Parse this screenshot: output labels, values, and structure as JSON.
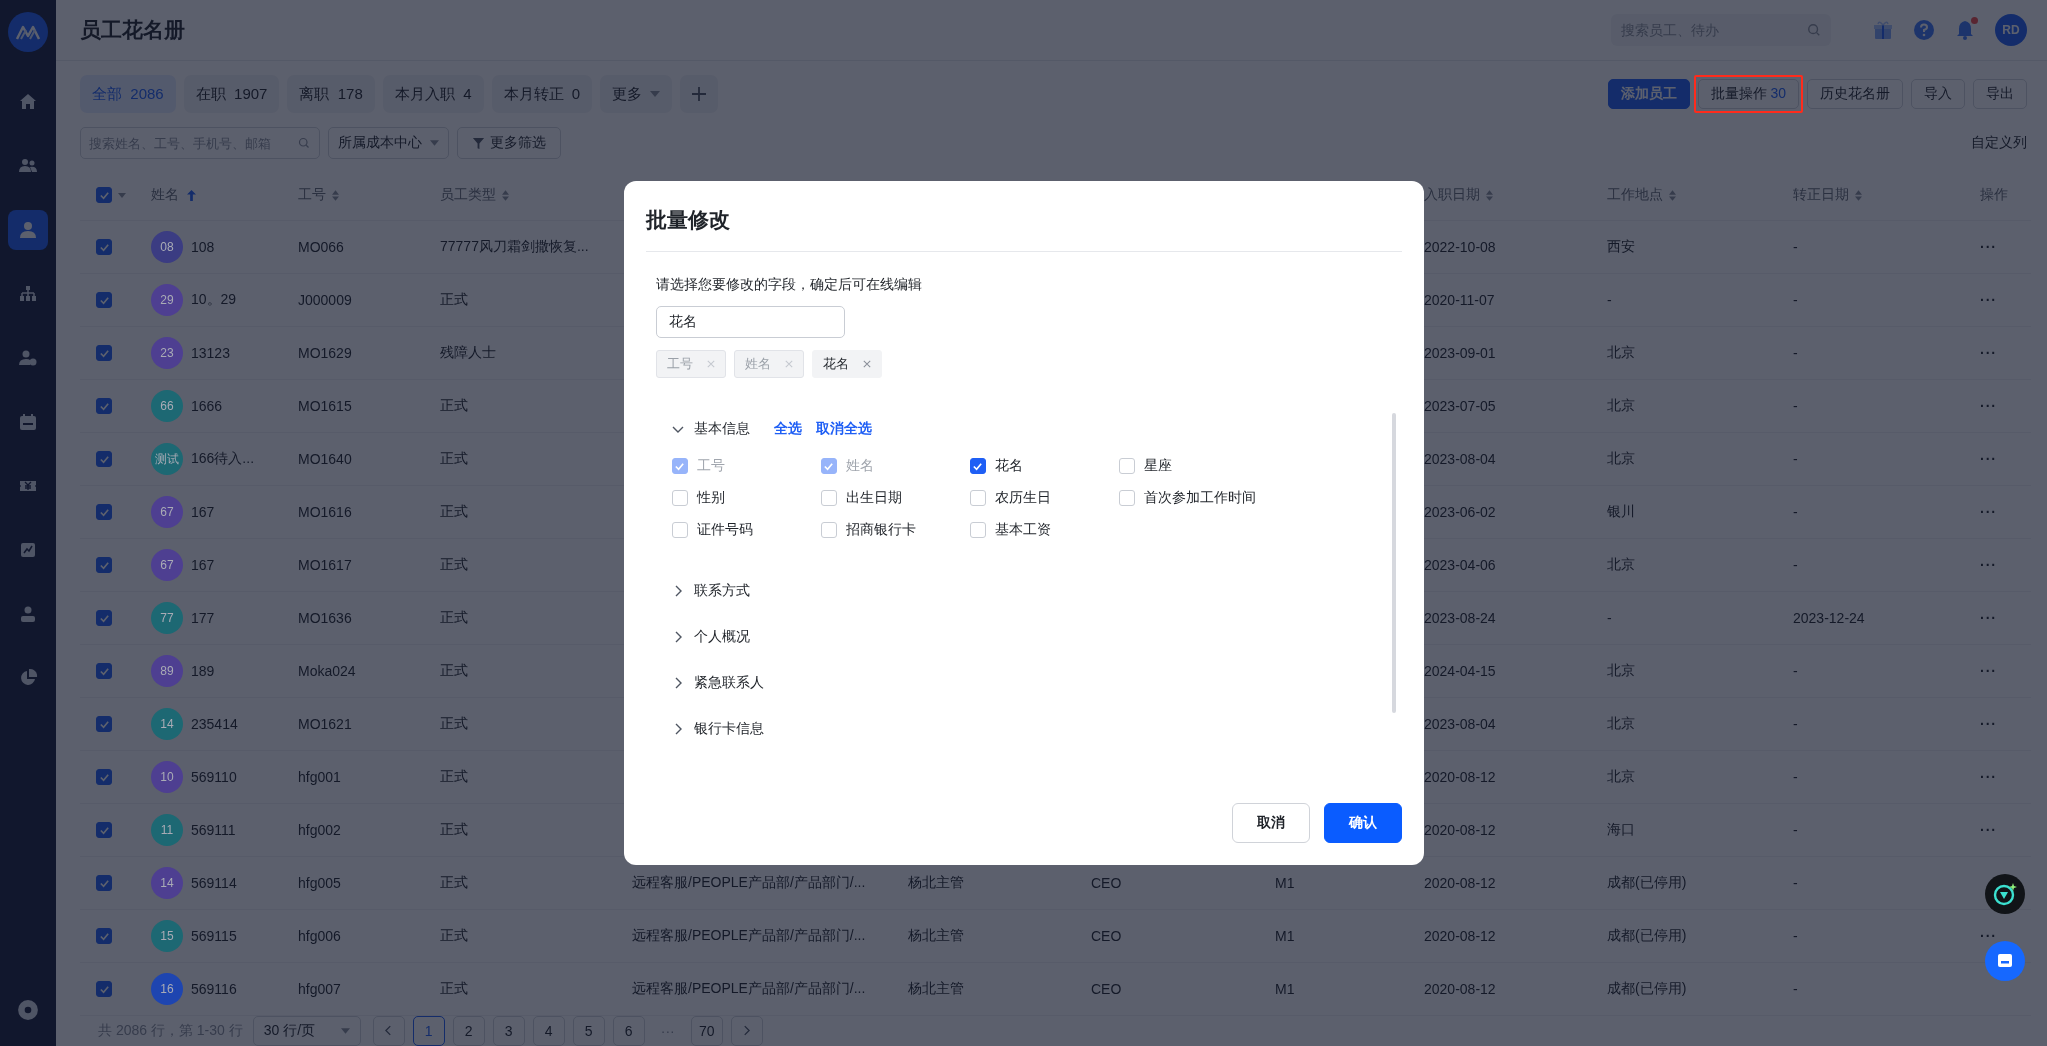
{
  "sidebar": {
    "items": [
      {
        "kind": "home",
        "selected": false
      },
      {
        "kind": "team",
        "selected": false
      },
      {
        "kind": "person",
        "selected": true
      },
      {
        "kind": "org",
        "selected": false
      },
      {
        "kind": "person-settings",
        "selected": false
      },
      {
        "kind": "calendar",
        "selected": false
      },
      {
        "kind": "finance",
        "selected": false
      },
      {
        "kind": "report",
        "selected": false
      },
      {
        "kind": "profile",
        "selected": false
      },
      {
        "kind": "pie",
        "selected": false
      }
    ],
    "bottom_item": {
      "kind": "settings"
    }
  },
  "header": {
    "title": "员工花名册",
    "search": {
      "placeholder": "搜索员工、待办"
    },
    "notification_dot": true,
    "avatar": "RD"
  },
  "tabs": [
    {
      "label": "全部",
      "count": "2086",
      "selected": true
    },
    {
      "label": "在职",
      "count": "1907",
      "selected": false
    },
    {
      "label": "离职",
      "count": "178",
      "selected": false
    },
    {
      "label": "本月入职",
      "count": "4",
      "selected": false
    },
    {
      "label": "本月转正",
      "count": "0",
      "selected": false
    }
  ],
  "more_tab": {
    "label": "更多"
  },
  "actions": [
    {
      "label": "添加员工",
      "kind": "primary"
    },
    {
      "label": "批量操作",
      "count": "30",
      "kind": "default",
      "highlighted": true
    },
    {
      "label": "历史花名册",
      "kind": "default"
    },
    {
      "label": "导入",
      "kind": "default"
    },
    {
      "label": "导出",
      "kind": "default"
    }
  ],
  "filters": {
    "search": {
      "placeholder": "搜索姓名、工号、手机号、邮箱"
    },
    "dropdown": "所属成本中心",
    "more_button": "更多筛选",
    "customize_link": "自定义列"
  },
  "table": {
    "all_checked": true,
    "columns": [
      {
        "label": "姓名",
        "sort_ascending": true
      },
      {
        "label": "工号",
        "sort_ascending": false
      },
      {
        "label": "员工类型",
        "sort_ascending": false
      },
      {
        "label": "入职日期",
        "sort_ascending": false
      },
      {
        "label": "工作地点",
        "sort_ascending": false
      },
      {
        "label": "转正日期",
        "sort_ascending": false
      },
      {
        "label": "操作"
      }
    ],
    "rows": [
      {
        "checked": true,
        "avatar": "08",
        "color": "#3b3c82",
        "name": "108",
        "employee_no": "MO066",
        "type": "77777风刀霜剑撒恢复...",
        "hire_date": "2022-10-08",
        "location": "西安",
        "regular_date": "-",
        "action": "···"
      },
      {
        "checked": true,
        "avatar": "29",
        "color": "#4e3f91",
        "name": "10。29",
        "employee_no": "J000009",
        "type": "正式",
        "hire_date": "2020-11-07",
        "location": "-",
        "regular_date": "-",
        "action": "···"
      },
      {
        "checked": true,
        "avatar": "23",
        "color": "#4e3f91",
        "name": "13123",
        "employee_no": "MO1629",
        "type": "残障人士",
        "hire_date": "2023-09-01",
        "location": "北京",
        "regular_date": "-",
        "action": "···"
      },
      {
        "checked": true,
        "avatar": "66",
        "color": "#1d6873",
        "name": "1666",
        "employee_no": "MO1615",
        "type": "正式",
        "hire_date": "2023-07-05",
        "location": "北京",
        "regular_date": "-",
        "action": "···"
      },
      {
        "checked": true,
        "avatar": "测试",
        "color": "#1d6873",
        "name": "166待入...",
        "employee_no": "MO1640",
        "type": "正式",
        "hire_date": "2023-08-04",
        "location": "北京",
        "regular_date": "-",
        "action": "···"
      },
      {
        "checked": true,
        "avatar": "67",
        "color": "#4e3f91",
        "name": "167",
        "employee_no": "MO1616",
        "type": "正式",
        "hire_date": "2023-06-02",
        "location": "银川",
        "regular_date": "-",
        "action": "···"
      },
      {
        "checked": true,
        "avatar": "67",
        "color": "#4e3f91",
        "name": "167",
        "employee_no": "MO1617",
        "type": "正式",
        "hire_date": "2023-04-06",
        "location": "北京",
        "regular_date": "-",
        "action": "···"
      },
      {
        "checked": true,
        "avatar": "77",
        "color": "#1d6873",
        "name": "177",
        "employee_no": "MO1636",
        "type": "正式",
        "hire_date": "2023-08-24",
        "location": "-",
        "regular_date": "2023-12-24",
        "action": "···"
      },
      {
        "checked": true,
        "avatar": "89",
        "color": "#4e3f91",
        "name": "189",
        "employee_no": "Moka024",
        "type": "正式",
        "hire_date": "2024-04-15",
        "location": "北京",
        "regular_date": "-",
        "action": "···"
      },
      {
        "checked": true,
        "avatar": "14",
        "color": "#1d6873",
        "name": "235414",
        "employee_no": "MO1621",
        "type": "正式",
        "hire_date": "2023-08-04",
        "location": "北京",
        "regular_date": "-",
        "action": "···"
      },
      {
        "checked": true,
        "avatar": "10",
        "color": "#4e3f91",
        "name": "569110",
        "employee_no": "hfg001",
        "type": "正式",
        "hire_date": "2020-08-12",
        "location": "北京",
        "regular_date": "-",
        "action": "···"
      },
      {
        "checked": true,
        "avatar": "11",
        "color": "#1d6873",
        "name": "569111",
        "employee_no": "hfg002",
        "type": "正式",
        "hire_date": "2020-08-12",
        "location": "海口",
        "regular_date": "-",
        "action": "···"
      },
      {
        "checked": true,
        "avatar": "14",
        "color": "#4e3f91",
        "name": "569114",
        "employee_no": "hfg005",
        "type": "正式",
        "department": "远程客服/PEOPLE产品部/产品部门/...",
        "manager": "杨北主管",
        "position": "CEO",
        "grade": "M1",
        "hire_date": "2020-08-12",
        "location": "成都(已停用)",
        "regular_date": "-"
      },
      {
        "checked": true,
        "avatar": "15",
        "color": "#1d6873",
        "name": "569115",
        "employee_no": "hfg006",
        "type": "正式",
        "department": "远程客服/PEOPLE产品部/产品部门/...",
        "manager": "杨北主管",
        "position": "CEO",
        "grade": "M1",
        "hire_date": "2020-08-12",
        "location": "成都(已停用)",
        "regular_date": "-",
        "action": "···"
      },
      {
        "checked": true,
        "avatar": "16",
        "color": "#1e45b0",
        "name": "569116",
        "employee_no": "hfg007",
        "type": "正式",
        "department": "远程客服/PEOPLE产品部/产品部门/...",
        "manager": "杨北主管",
        "position": "CEO",
        "grade": "M1",
        "hire_date": "2020-08-12",
        "location": "成都(已停用)",
        "regular_date": "-"
      }
    ]
  },
  "pagination": {
    "summary": "共 2086 行，第 1-30 行",
    "page_size": "30 行/页",
    "pages": [
      {
        "label": "1",
        "selected": true
      },
      {
        "label": "2",
        "selected": false
      },
      {
        "label": "3",
        "selected": false
      },
      {
        "label": "4",
        "selected": false
      },
      {
        "label": "5",
        "selected": false
      },
      {
        "label": "6",
        "selected": false
      }
    ],
    "ellipsis": "···",
    "last_page": {
      "label": "70",
      "selected": false
    }
  },
  "modal": {
    "title": "批量修改",
    "hint": "请选择您要修改的字段，确定后可在线编辑",
    "search": {
      "value": "花名"
    },
    "tags": [
      {
        "label": "工号",
        "disabled": true
      },
      {
        "label": "姓名",
        "disabled": true
      },
      {
        "label": "花名",
        "disabled": false
      }
    ],
    "sections": [
      {
        "title": "基本信息",
        "expanded": true,
        "actions": [
          "全选",
          "取消全选"
        ],
        "fields": [
          {
            "label": "工号",
            "checked": true,
            "disabled": true
          },
          {
            "label": "姓名",
            "checked": true,
            "disabled": true
          },
          {
            "label": "花名",
            "checked": true,
            "disabled": false
          },
          {
            "label": "星座",
            "checked": false,
            "disabled": false
          },
          {
            "label": "性别",
            "checked": false,
            "disabled": false
          },
          {
            "label": "出生日期",
            "checked": false,
            "disabled": false
          },
          {
            "label": "农历生日",
            "checked": false,
            "disabled": false
          },
          {
            "label": "首次参加工作时间",
            "checked": false,
            "disabled": false
          },
          {
            "label": "证件号码",
            "checked": false,
            "disabled": false
          },
          {
            "label": "招商银行卡",
            "checked": false,
            "disabled": false
          },
          {
            "label": "基本工资",
            "checked": false,
            "disabled": false
          }
        ]
      },
      {
        "title": "联系方式",
        "expanded": false
      },
      {
        "title": "个人概况",
        "expanded": false
      },
      {
        "title": "紧急联系人",
        "expanded": false
      },
      {
        "title": "银行卡信息",
        "expanded": false
      }
    ],
    "buttons": [
      {
        "label": "取消",
        "kind": "default"
      },
      {
        "label": "确认",
        "kind": "primary"
      }
    ]
  },
  "floating_buttons": [
    {
      "kind": "assistant"
    },
    {
      "kind": "chat"
    }
  ]
}
